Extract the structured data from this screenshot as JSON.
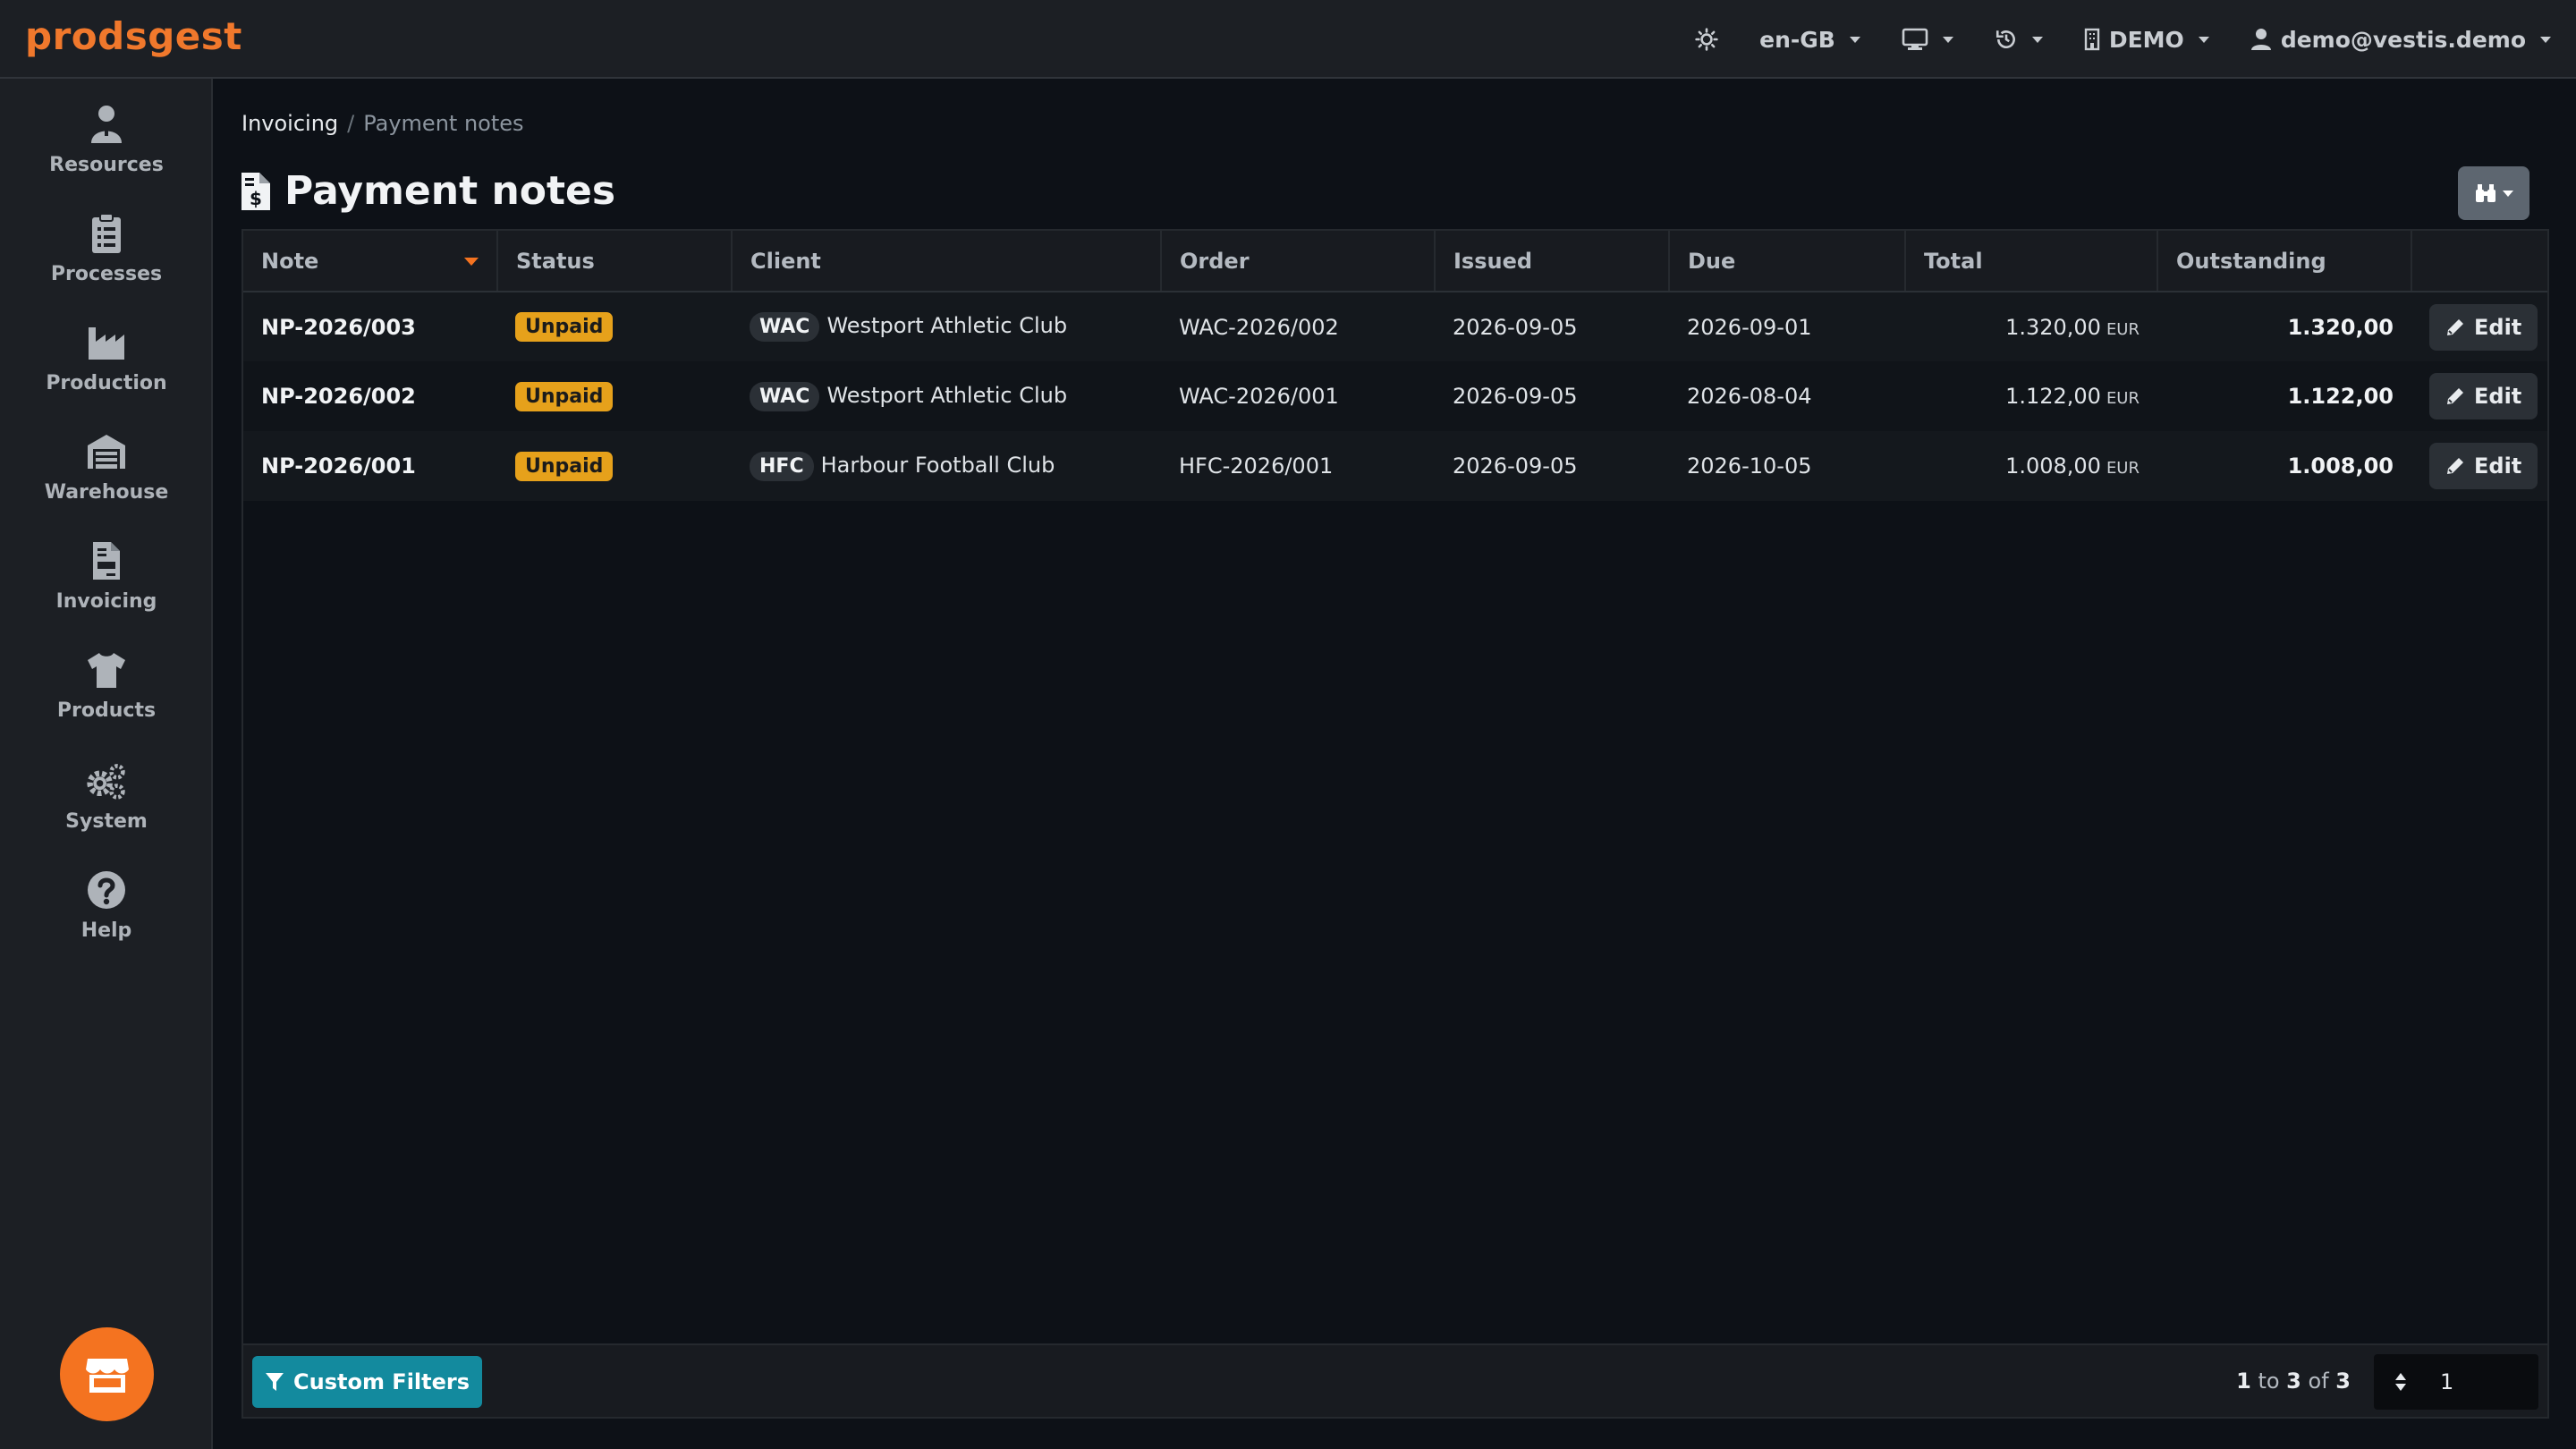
{
  "app": {
    "brand": "prodsgest"
  },
  "topnav": {
    "theme_icon": "sun-icon",
    "language": "en-GB",
    "display_icon": "monitor-icon",
    "history_icon": "history-icon",
    "company": "DEMO",
    "user": "demo@vestis.demo"
  },
  "sidebar": {
    "items": [
      {
        "label": "Resources",
        "icon": "resources-icon"
      },
      {
        "label": "Processes",
        "icon": "clipboard-icon"
      },
      {
        "label": "Production",
        "icon": "factory-icon"
      },
      {
        "label": "Warehouse",
        "icon": "warehouse-icon"
      },
      {
        "label": "Invoicing",
        "icon": "invoice-icon"
      },
      {
        "label": "Products",
        "icon": "tshirt-icon"
      },
      {
        "label": "System",
        "icon": "gears-icon"
      },
      {
        "label": "Help",
        "icon": "help-icon"
      }
    ]
  },
  "breadcrumb": {
    "parent": "Invoicing",
    "separator": "/",
    "current": "Payment notes"
  },
  "page": {
    "title": "Payment notes"
  },
  "table": {
    "columns": [
      "Note",
      "Status",
      "Client",
      "Order",
      "Issued",
      "Due",
      "Total",
      "Outstanding",
      ""
    ],
    "rows": [
      {
        "note": "NP-2026/003",
        "status": "Unpaid",
        "client_code": "WAC",
        "client_name": "Westport Athletic Club",
        "order": "WAC-2026/002",
        "issued": "2026-09-05",
        "due": "2026-09-01",
        "total": "1.320,00",
        "currency": "EUR",
        "outstanding": "1.320,00",
        "action": "Edit"
      },
      {
        "note": "NP-2026/002",
        "status": "Unpaid",
        "client_code": "WAC",
        "client_name": "Westport Athletic Club",
        "order": "WAC-2026/001",
        "issued": "2026-09-05",
        "due": "2026-08-04",
        "total": "1.122,00",
        "currency": "EUR",
        "outstanding": "1.122,00",
        "action": "Edit"
      },
      {
        "note": "NP-2026/001",
        "status": "Unpaid",
        "client_code": "HFC",
        "client_name": "Harbour Football Club",
        "order": "HFC-2026/001",
        "issued": "2026-09-05",
        "due": "2026-10-05",
        "total": "1.008,00",
        "currency": "EUR",
        "outstanding": "1.008,00",
        "action": "Edit"
      }
    ]
  },
  "footer": {
    "filter_button": "Custom Filters",
    "range_from": "1",
    "range_to_word": "to",
    "range_to": "3",
    "range_of_word": "of",
    "range_total": "3",
    "page_value": "1"
  },
  "colors": {
    "accent": "#f47320",
    "badge_unpaid": "#e6a11b",
    "filter_button": "#138a9e"
  }
}
